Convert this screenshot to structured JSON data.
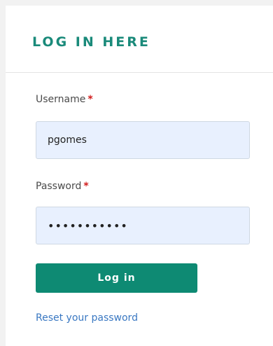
{
  "form": {
    "title": "LOG IN HERE",
    "username_label": "Username",
    "username_value": "pgomes",
    "password_label": "Password",
    "password_value": "•••••••••••",
    "required_marker": "*",
    "login_label": "Log in",
    "reset_link": "Reset your password"
  },
  "colors": {
    "accent": "#0e8a73",
    "title": "#1a8a7a",
    "required": "#d11b1b",
    "link": "#3a78c2",
    "input_bg": "#e8f0fe"
  }
}
